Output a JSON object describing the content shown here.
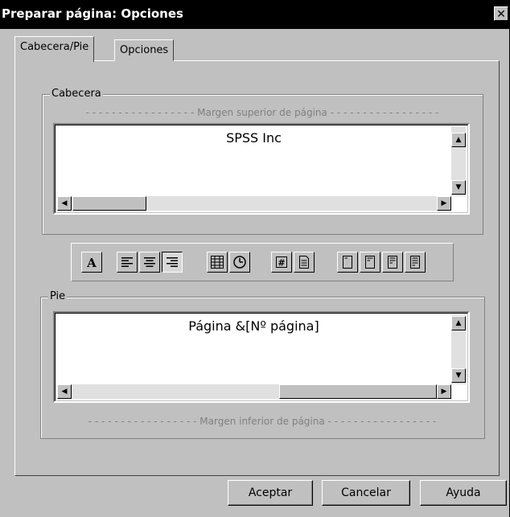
{
  "window": {
    "title": "Preparar página: Opciones",
    "close_glyph": "✕"
  },
  "tabs": [
    {
      "label": "Cabecera/Pie",
      "active": true
    },
    {
      "label": "Opciones",
      "active": false
    }
  ],
  "header_group": {
    "label": "Cabecera",
    "margin_text": "Margen superior de página",
    "content": "SPSS Inc"
  },
  "footer_group": {
    "label": "Pie",
    "margin_text": "Margen inferior de página",
    "content": "Página &[Nº página]"
  },
  "toolbar_icons": [
    "font-icon",
    "align-left-icon",
    "align-center-icon",
    "align-right-icon",
    "date-icon",
    "clock-icon",
    "page-number-icon",
    "page-icon",
    "header-style-1-icon",
    "header-style-2-icon",
    "header-style-3-icon",
    "header-style-4-icon"
  ],
  "scroll_glyphs": {
    "up": "▲",
    "down": "▼",
    "left": "◀",
    "right": "▶"
  },
  "buttons": {
    "ok": "Aceptar",
    "cancel": "Cancelar",
    "help": "Ayuda"
  },
  "dashes": "- - - - - - - - - - - - - - - - -"
}
